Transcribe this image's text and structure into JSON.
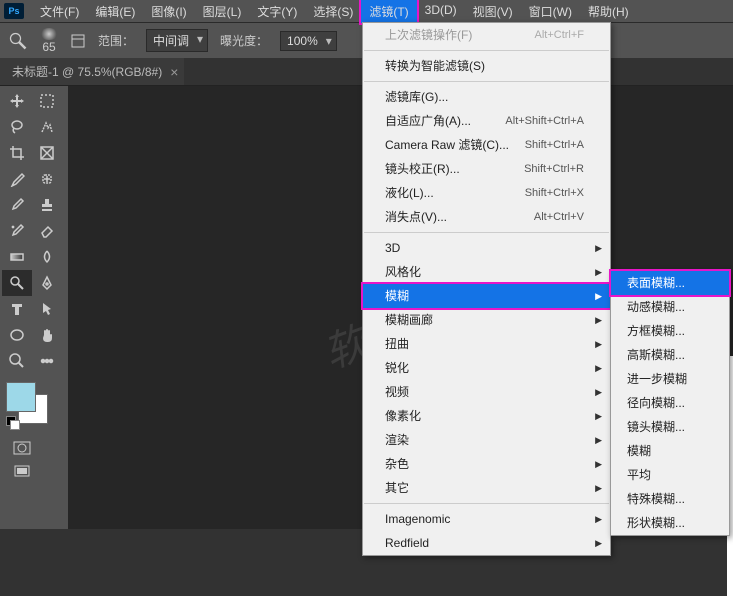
{
  "ps_logo": "Ps",
  "menu": [
    "文件(F)",
    "编辑(E)",
    "图像(I)",
    "图层(L)",
    "文字(Y)",
    "选择(S)",
    "滤镜(T)",
    "3D(D)",
    "视图(V)",
    "窗口(W)",
    "帮助(H)"
  ],
  "active_menu_index": 6,
  "options": {
    "brush_size": "65",
    "range_label": "范围：",
    "range_value": "中间调",
    "exposure_label": "曝光度：",
    "exposure_value": "100%"
  },
  "doc_tab": {
    "title": "未标题-1 @ 75.5%(RGB/8#)",
    "close": "×"
  },
  "dropdown": [
    {
      "label": "上次滤镜操作(F)",
      "shortcut": "Alt+Ctrl+F",
      "disabled": true
    },
    {
      "sep": true
    },
    {
      "label": "转换为智能滤镜(S)"
    },
    {
      "sep": true
    },
    {
      "label": "滤镜库(G)..."
    },
    {
      "label": "自适应广角(A)...",
      "shortcut": "Alt+Shift+Ctrl+A"
    },
    {
      "label": "Camera Raw 滤镜(C)...",
      "shortcut": "Shift+Ctrl+A"
    },
    {
      "label": "镜头校正(R)...",
      "shortcut": "Shift+Ctrl+R"
    },
    {
      "label": "液化(L)...",
      "shortcut": "Shift+Ctrl+X"
    },
    {
      "label": "消失点(V)...",
      "shortcut": "Alt+Ctrl+V"
    },
    {
      "sep": true
    },
    {
      "label": "3D",
      "sub": true
    },
    {
      "label": "风格化",
      "sub": true
    },
    {
      "label": "模糊",
      "sub": true,
      "hl": true
    },
    {
      "label": "模糊画廊",
      "sub": true
    },
    {
      "label": "扭曲",
      "sub": true
    },
    {
      "label": "锐化",
      "sub": true
    },
    {
      "label": "视频",
      "sub": true
    },
    {
      "label": "像素化",
      "sub": true
    },
    {
      "label": "渲染",
      "sub": true
    },
    {
      "label": "杂色",
      "sub": true
    },
    {
      "label": "其它",
      "sub": true
    },
    {
      "sep": true
    },
    {
      "label": "Imagenomic",
      "sub": true
    },
    {
      "label": "Redfield",
      "sub": true
    }
  ],
  "submenu": [
    {
      "label": "表面模糊...",
      "hl": true
    },
    {
      "label": "动感模糊..."
    },
    {
      "label": "方框模糊..."
    },
    {
      "label": "高斯模糊..."
    },
    {
      "label": "进一步模糊"
    },
    {
      "label": "径向模糊..."
    },
    {
      "label": "镜头模糊..."
    },
    {
      "label": "模糊"
    },
    {
      "label": "平均"
    },
    {
      "label": "特殊模糊..."
    },
    {
      "label": "形状模糊..."
    }
  ],
  "watermark": "软件自学网"
}
